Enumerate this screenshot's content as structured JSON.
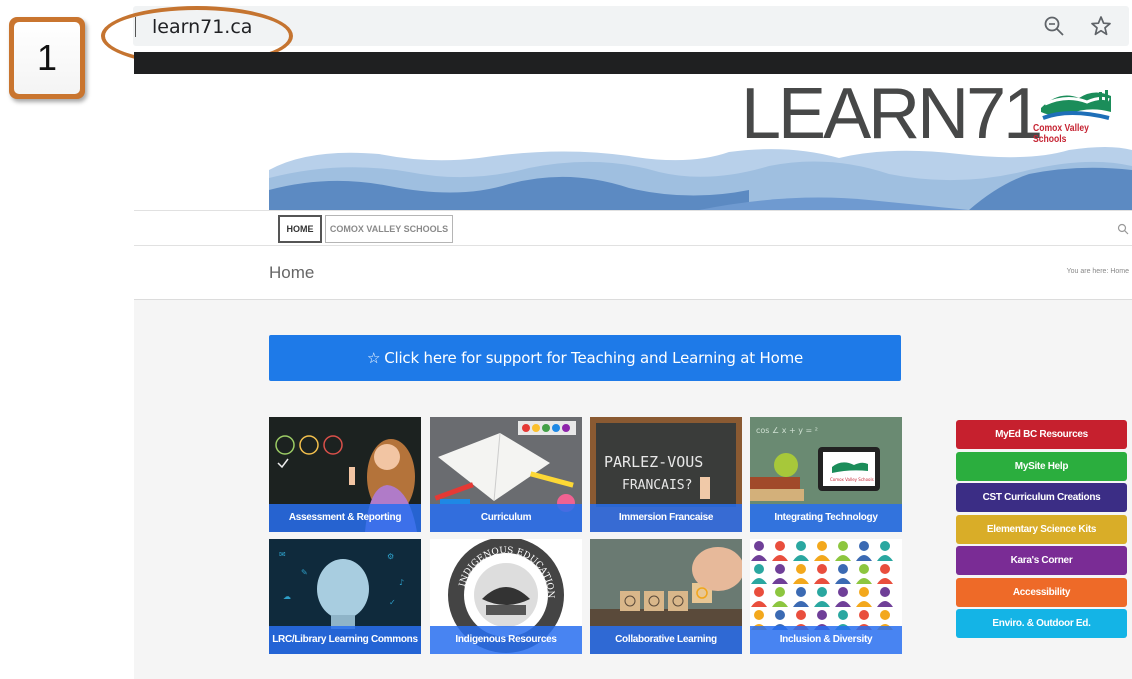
{
  "step_badge": "1",
  "browser": {
    "url": "learn71.ca",
    "zoom_icon": "zoom-out-icon",
    "bookmark_icon": "star-outline-icon"
  },
  "header": {
    "logo": "LEARN71",
    "logo_subtitle": "Comox Valley Schools"
  },
  "nav": {
    "tabs": [
      {
        "label": "HOME"
      },
      {
        "label": "COMOX VALLEY SCHOOLS"
      }
    ],
    "search_icon": "search-icon"
  },
  "page": {
    "title": "Home",
    "breadcrumb": "You are here:  Home"
  },
  "support_button": {
    "icon": "☆",
    "label": "Click here for support for Teaching and Learning at Home"
  },
  "tiles": [
    {
      "label": "Assessment & Reporting"
    },
    {
      "label": "Curriculum"
    },
    {
      "label": "Immersion Francaise"
    },
    {
      "label": "Integrating Technology"
    },
    {
      "label": "LRC/Library Learning Commons"
    },
    {
      "label": "Indigenous Resources"
    },
    {
      "label": "Collaborative Learning"
    },
    {
      "label": "Inclusion & Diversity"
    }
  ],
  "tile_image_text": {
    "chalkboard": "PARLEZ-VOUS FRANCAIS?",
    "indigenous_ring": "INDIGENOUS EDUCATION",
    "tablet": "Comox Valley Schools"
  },
  "side_buttons": [
    {
      "label": "MyEd BC Resources",
      "color": "#c6202e"
    },
    {
      "label": "MySite Help",
      "color": "#2bae3e"
    },
    {
      "label": "CST Curriculum Creations",
      "color": "#3b2d85"
    },
    {
      "label": "Elementary Science Kits",
      "color": "#d9ad28"
    },
    {
      "label": "Kara's Corner",
      "color": "#7a2c95"
    },
    {
      "label": "Accessibility",
      "color": "#ee6a28"
    },
    {
      "label": "Enviro. & Outdoor Ed.",
      "color": "#14b4e6"
    }
  ],
  "colors": {
    "accent_blue": "#1e7ae8",
    "highlight_orange": "#c57430"
  }
}
